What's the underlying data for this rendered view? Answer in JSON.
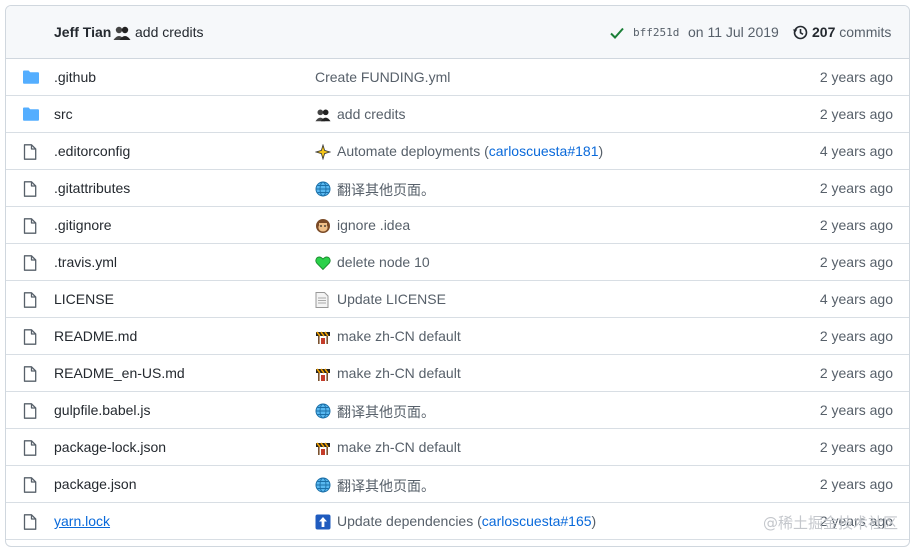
{
  "header": {
    "author": "Jeff Tian",
    "avatar_icon": "avatar-icon",
    "message": "add credits",
    "status_icon": "check-icon",
    "status_color": "#1a7f37",
    "sha": "bff251d",
    "date": "on 11 Jul 2019",
    "history_icon": "history-icon",
    "commit_count": "207",
    "commits_label": "commits"
  },
  "files": [
    {
      "name": ".github",
      "type": "dir",
      "icon": "folder-icon",
      "msg": "Create FUNDING.yml",
      "emoji": "",
      "pr": "",
      "msg_after": "",
      "age": "2 years ago"
    },
    {
      "name": "src",
      "type": "dir",
      "icon": "folder-icon",
      "msg": "add credits",
      "emoji": "avatar",
      "pr": "",
      "msg_after": "",
      "age": "2 years ago"
    },
    {
      "name": ".editorconfig",
      "type": "file",
      "icon": "file-icon",
      "msg": "Automate deployments (",
      "emoji": "sparkles",
      "pr": "carloscuesta#181",
      "msg_after": ")",
      "age": "4 years ago"
    },
    {
      "name": ".gitattributes",
      "type": "file",
      "icon": "file-icon",
      "msg": "翻译其他页面。",
      "emoji": "globe",
      "pr": "",
      "msg_after": "",
      "age": "2 years ago"
    },
    {
      "name": ".gitignore",
      "type": "file",
      "icon": "file-icon",
      "msg": "ignore .idea",
      "emoji": "monkey",
      "pr": "",
      "msg_after": "",
      "age": "2 years ago"
    },
    {
      "name": ".travis.yml",
      "type": "file",
      "icon": "file-icon",
      "msg": "delete node 10",
      "emoji": "green-heart",
      "pr": "",
      "msg_after": "",
      "age": "2 years ago"
    },
    {
      "name": "LICENSE",
      "type": "file",
      "icon": "file-icon",
      "msg": "Update LICENSE",
      "emoji": "page",
      "pr": "",
      "msg_after": "",
      "age": "4 years ago"
    },
    {
      "name": "README.md",
      "type": "file",
      "icon": "file-icon",
      "msg": "make zh-CN default",
      "emoji": "construction",
      "pr": "",
      "msg_after": "",
      "age": "2 years ago"
    },
    {
      "name": "README_en-US.md",
      "type": "file",
      "icon": "file-icon",
      "msg": "make zh-CN default",
      "emoji": "construction",
      "pr": "",
      "msg_after": "",
      "age": "2 years ago"
    },
    {
      "name": "gulpfile.babel.js",
      "type": "file",
      "icon": "file-icon",
      "msg": "翻译其他页面。",
      "emoji": "globe",
      "pr": "",
      "msg_after": "",
      "age": "2 years ago"
    },
    {
      "name": "package-lock.json",
      "type": "file",
      "icon": "file-icon",
      "msg": "make zh-CN default",
      "emoji": "construction",
      "pr": "",
      "msg_after": "",
      "age": "2 years ago"
    },
    {
      "name": "package.json",
      "type": "file",
      "icon": "file-icon",
      "msg": "翻译其他页面。",
      "emoji": "globe",
      "pr": "",
      "msg_after": "",
      "age": "2 years ago"
    },
    {
      "name": "yarn.lock",
      "type": "file",
      "icon": "file-icon",
      "msg": "Update dependencies (",
      "emoji": "arrow-up",
      "pr": "carloscuesta#165",
      "msg_after": ")",
      "age": "2 years ago",
      "link": true
    }
  ],
  "watermark": "@稀土掘金技术社区",
  "colors": {
    "folder": "#54aeff",
    "link": "#0969da",
    "muted": "#57606a",
    "border": "#d0d7de"
  }
}
